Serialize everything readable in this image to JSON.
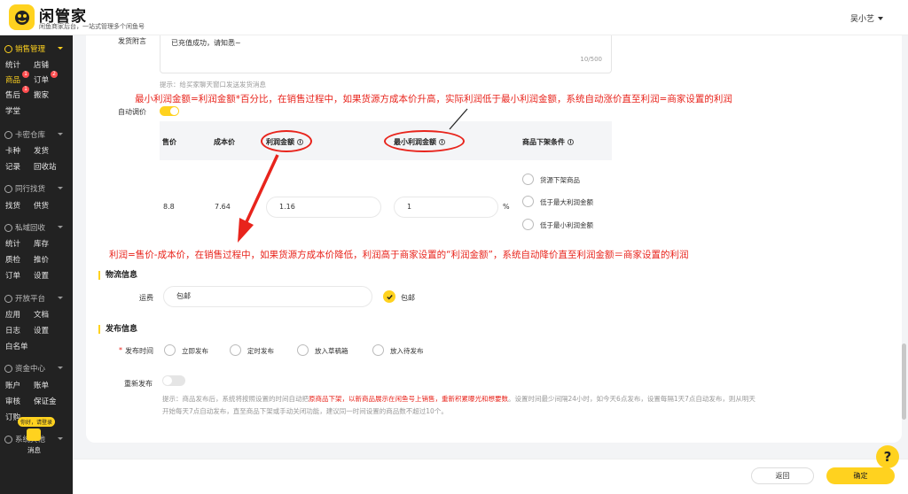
{
  "brand": {
    "name": "闲管家",
    "tagline": "闲鱼商家后台，一站式管理多个闲鱼号"
  },
  "user": {
    "name": "吴小艺"
  },
  "sidebar": {
    "sections": [
      {
        "label": "销售管理",
        "icon": "shop-icon"
      },
      {
        "label": "卡密仓库",
        "icon": "warehouse-icon"
      },
      {
        "label": "同行找货",
        "icon": "search-goods-icon"
      },
      {
        "label": "私域回收",
        "icon": "recycle-icon"
      },
      {
        "label": "开放平台",
        "icon": "platform-icon"
      },
      {
        "label": "资金中心",
        "icon": "money-icon"
      },
      {
        "label": "系统其他",
        "icon": "settings-icon"
      }
    ],
    "items": [
      "统计",
      "店铺",
      "商品",
      "订单",
      "售后",
      "搬家",
      "学堂",
      "卡种",
      "发货",
      "记录",
      "回收站",
      "找货",
      "供货",
      "统计",
      "库存",
      "质检",
      "推价",
      "订单",
      "设置",
      "应用",
      "文档",
      "日志",
      "设置",
      "白名单",
      "账户",
      "账单",
      "审核",
      "保证金",
      "订购"
    ],
    "badges": [
      "1",
      "2",
      "1"
    ],
    "help_bubble": "你好，请登录",
    "msg_label": "消息"
  },
  "form": {
    "note_label": "发货附言",
    "note_value": "已充值成功，请知悉~",
    "note_count": "10/500",
    "note_hint": "提示：给买家聊天窗口发送发货消息",
    "auto_label": "自动调价",
    "table_headers": [
      "售价",
      "成本价",
      "利润金额",
      "最小利润金额",
      "商品下架条件"
    ],
    "info_icon": "i",
    "row": {
      "price": "8.8",
      "cost": "7.64",
      "profit": "1.16",
      "min_profit": "1",
      "unit": "%"
    },
    "delist_options": [
      "货源下架商品",
      "低于最大利润金额",
      "低于最小利润金额"
    ],
    "logistics_title": "物流信息",
    "freight_label": "运费",
    "freight_value": "包邮",
    "freight_check_label": "包邮",
    "publish_title": "发布信息",
    "publish_required": "*",
    "publish_time_label": "发布时间",
    "publish_options": [
      "立即发布",
      "定时发布",
      "放入草稿箱",
      "放入待发布"
    ],
    "repub_label": "重新发布",
    "repub_hint_pre": "提示：商品发布后，系统将按照设置的时间自动把",
    "repub_hint_red": "原商品下架，以新商品展示在闲鱼号上销售，重新积累曝光和想要数",
    "repub_hint_post": "。设置时间最少间隔24小时，如今天6点发布，设置每隔1天7点自动发布，则从明天",
    "repub_hint_line2": "开始每天7点自动发布，直至商品下架或手动关闭功能，建议同一时间设置的商品数不超过10个。"
  },
  "annotations": {
    "top": "最小利润金额=利润金额*百分比，在销售过程中，如果货源方成本价升高，实际利润低于最小利润金额，系统自动涨价直至利润=商家设置的利润",
    "bottom": "利润=售价-成本价，在销售过程中，如果货源方成本价降低，利润高于商家设置的“利润金额”，系统自动降价直至利润金额＝商家设置的利润",
    "color": "#e8241c"
  },
  "footer": {
    "back_label": "返回",
    "ok_label": "确定",
    "help_label": "?"
  },
  "colors": {
    "accent": "#ffd21f",
    "sidebar": "#222222",
    "annotation": "#e8241c"
  }
}
